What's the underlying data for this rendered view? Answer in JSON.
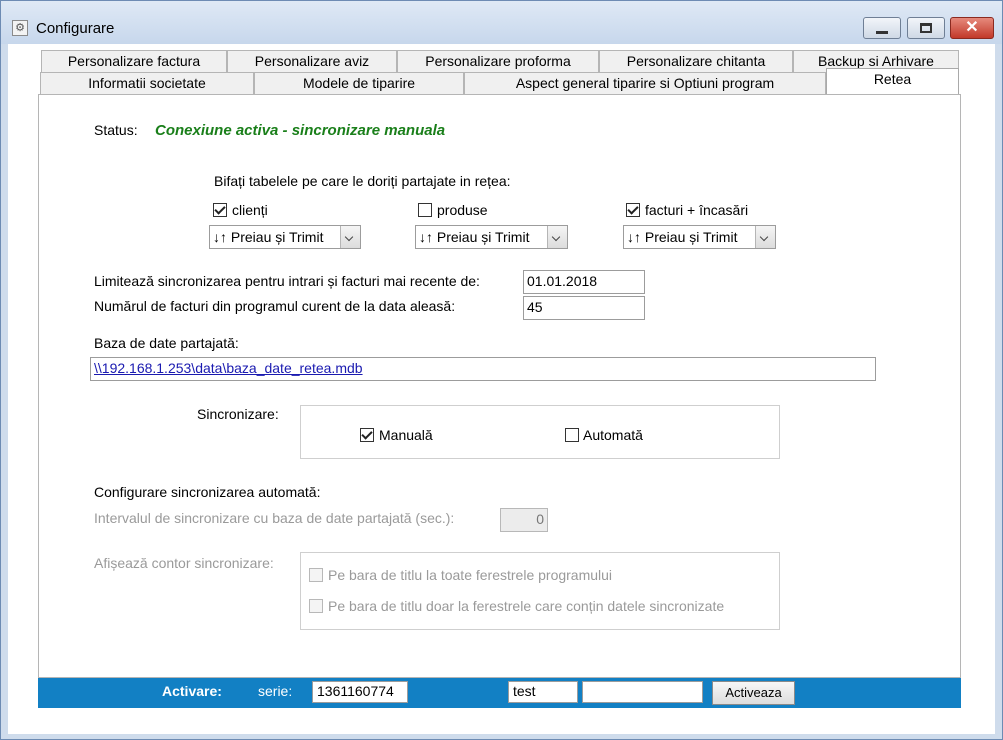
{
  "window": {
    "title": "Configurare",
    "app_icon": "gear-icon",
    "controls": [
      "minimize-icon",
      "maximize-icon",
      "close-icon"
    ]
  },
  "tabs": {
    "row1": [
      "Personalizare factura",
      "Personalizare aviz",
      "Personalizare proforma",
      "Personalizare chitanta",
      "Backup si Arhivare"
    ],
    "row2": [
      "Informatii societate",
      "Modele de tiparire",
      "Aspect general tiparire si Optiuni program",
      "Retea"
    ],
    "active": "Retea"
  },
  "status": {
    "label": "Status:",
    "value": "Conexiune activa - sincronizare manuala",
    "value_color": "#1a7f1a"
  },
  "share": {
    "heading": "Bifați tabelele pe care le doriți partajate in rețea:",
    "tables": [
      {
        "label": "clienți",
        "checked": true,
        "mode": "↓↑ Preiau și Trimit"
      },
      {
        "label": "produse",
        "checked": false,
        "mode": "↓↑ Preiau și Trimit"
      },
      {
        "label": "facturi + încasări",
        "checked": true,
        "mode": "↓↑ Preiau și Trimit"
      }
    ]
  },
  "limit": {
    "date_label": "Limitează sincronizarea pentru intrari și facturi mai recente de:",
    "date_value": "01.01.2018",
    "count_label": "Numărul de facturi din programul curent de la data aleasă:",
    "count_value": "45"
  },
  "database": {
    "label": "Baza de date partajată:",
    "path": "\\\\192.168.1.253\\data\\baza_date_retea.mdb",
    "link_color": "#1a1ab0"
  },
  "sync": {
    "label": "Sincronizare:",
    "manual_label": "Manuală",
    "manual_checked": true,
    "auto_label": "Automată",
    "auto_checked": false
  },
  "auto_config": {
    "heading": "Configurare sincronizarea automată:",
    "interval_label": "Intervalul de sincronizare cu baza de date partajată (sec.):",
    "interval_value": "0",
    "counter_label": "Afișează contor sincronizare:",
    "counter_options": [
      {
        "label": "Pe bara de titlu la toate ferestrele programului",
        "checked": false
      },
      {
        "label": "Pe bara de titlu doar la ferestrele care conțin datele sincronizate",
        "checked": false
      }
    ]
  },
  "activation": {
    "label": "Activare:",
    "serie_label": "serie:",
    "serie_value": "1361160774",
    "name_value": "test",
    "code_value": "",
    "button_label": "Activeaza",
    "bar_color": "#1280c4"
  }
}
